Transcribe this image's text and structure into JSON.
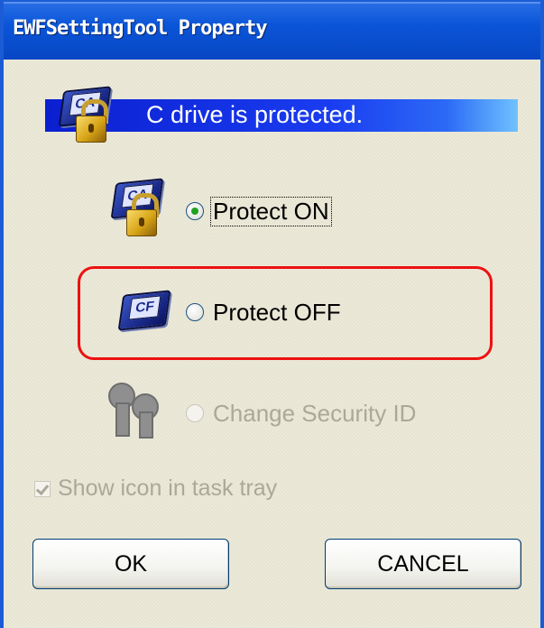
{
  "window": {
    "title": "EWFSettingTool Property"
  },
  "status": {
    "banner_text": "C drive is protected.",
    "accent": "#1a3cf0"
  },
  "options": {
    "protect_on": {
      "label": "Protect ON",
      "checked": true,
      "icon": "card-lock-icon"
    },
    "protect_off": {
      "label": "Protect OFF",
      "checked": false,
      "icon": "card-icon",
      "highlight_color": "#ee1111"
    },
    "change_security": {
      "label": "Change Security ID",
      "enabled": false,
      "icon": "keys-icon"
    }
  },
  "show_icon": {
    "label": "Show icon in task tray",
    "checked": true,
    "enabled": false
  },
  "buttons": {
    "ok": "OK",
    "cancel": "CANCEL"
  }
}
